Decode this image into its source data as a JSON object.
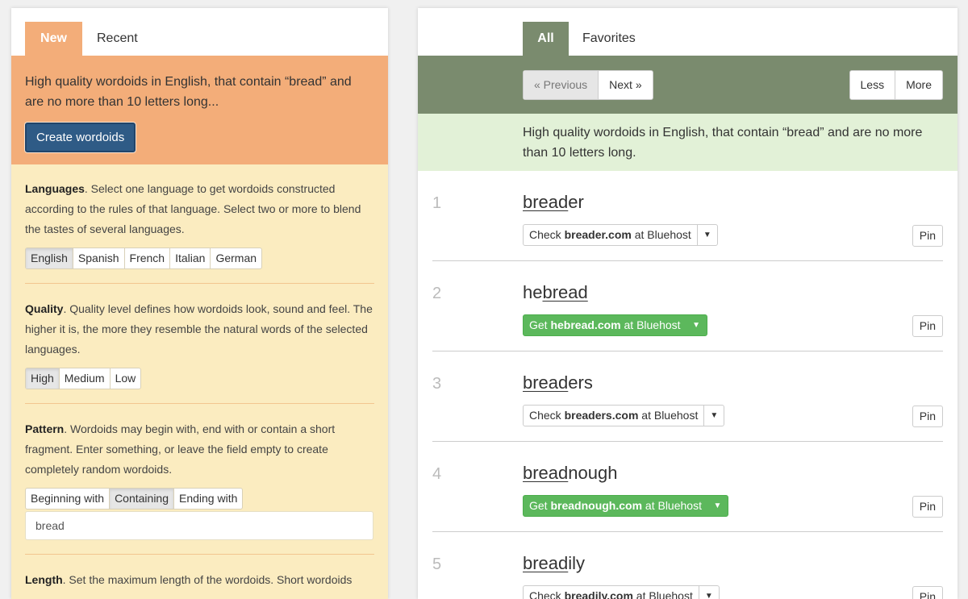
{
  "left": {
    "tabs": [
      {
        "label": "New"
      },
      {
        "label": "Recent"
      }
    ],
    "hero_text": "High quality wordoids in English, that contain “bread” and are no more than 10 letters long...",
    "create_label": "Create wordoids",
    "languages": {
      "title": "Languages",
      "text": ". Select one language to get wordoids constructed according to the rules of that language. Select two or more to blend the tastes of several languages.",
      "options": [
        "English",
        "Spanish",
        "French",
        "Italian",
        "German"
      ],
      "selected": "English"
    },
    "quality": {
      "title": "Quality",
      "text": ". Quality level defines how wordoids look, sound and feel. The higher it is, the more they resemble the natural words of the selected languages.",
      "options": [
        "High",
        "Medium",
        "Low"
      ],
      "selected": "High"
    },
    "pattern": {
      "title": "Pattern",
      "text": ". Wordoids may begin with, end with or contain a short fragment. Enter something, or leave the field empty to create completely random wordoids.",
      "options": [
        "Beginning with",
        "Containing",
        "Ending with"
      ],
      "selected": "Containing",
      "value": "bread"
    },
    "length": {
      "title": "Length",
      "text": ". Set the maximum length of the wordoids. Short wordoids"
    }
  },
  "right": {
    "tabs": [
      {
        "label": "All"
      },
      {
        "label": "Favorites"
      }
    ],
    "prev_label": "« Previous",
    "next_label": "Next »",
    "less_label": "Less",
    "more_label": "More",
    "summary": "High quality wordoids in English, that contain “bread” and are no more than 10 letters long.",
    "pin_label": "Pin",
    "results": [
      {
        "num": "1",
        "pre": "",
        "hl": "bread",
        "post": "er",
        "kind": "check",
        "prefix": "Check ",
        "domain": "breader.com",
        "suffix": " at Bluehost"
      },
      {
        "num": "2",
        "pre": "he",
        "hl": "bread",
        "post": "",
        "kind": "get",
        "prefix": "Get ",
        "domain": "hebread.com",
        "suffix": " at Bluehost"
      },
      {
        "num": "3",
        "pre": "",
        "hl": "bread",
        "post": "ers",
        "kind": "check",
        "prefix": "Check ",
        "domain": "breaders.com",
        "suffix": " at Bluehost"
      },
      {
        "num": "4",
        "pre": "",
        "hl": "bread",
        "post": "nough",
        "kind": "get",
        "prefix": "Get ",
        "domain": "breadnough.com",
        "suffix": " at Bluehost"
      },
      {
        "num": "5",
        "pre": "",
        "hl": "bread",
        "post": "ily",
        "kind": "check",
        "prefix": "Check ",
        "domain": "breadily.com",
        "suffix": " at Bluehost"
      }
    ]
  },
  "colors": {
    "orange": "#f3ad79",
    "cream": "#fbecc0",
    "olive": "#7a8b6e",
    "mint": "#e2f1d7",
    "button_blue": "#2f5b86",
    "green": "#5cb85c"
  }
}
